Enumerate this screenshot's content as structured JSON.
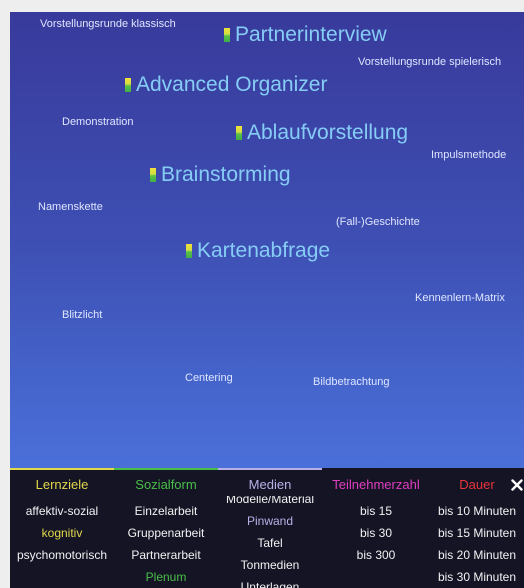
{
  "colors": {
    "background_top": "#383a9b",
    "background_bottom": "#4b70d9",
    "featured_word": "#86cdf5",
    "word": "#dfe6ff",
    "panel": "#141425",
    "item": "#f2f2f2"
  },
  "cloud": {
    "featured": [
      {
        "label": "Partnerinterview",
        "icon": "category-bar-icon"
      },
      {
        "label": "Advanced Organizer",
        "icon": "category-bar-icon"
      },
      {
        "label": "Ablaufvorstellung",
        "icon": "category-bar-icon"
      },
      {
        "label": "Brainstorming",
        "icon": "category-bar-icon"
      },
      {
        "label": "Kartenabfrage",
        "icon": "category-bar-icon"
      }
    ],
    "words": [
      "Vorstellungsrunde klassisch",
      "Vorstellungsrunde spielerisch",
      "Demonstration",
      "Impulsmethode",
      "Namenskette",
      "(Fall-)Geschichte",
      "Kennenlern-Matrix",
      "Blitzlicht",
      "Centering",
      "Bildbetrachtung"
    ]
  },
  "filters": {
    "columns": [
      {
        "title": "Lernziele",
        "color": "#e2d84a",
        "items": [
          "affektiv-sozial",
          "kognitiv",
          "psychomotorisch"
        ],
        "selected": [
          "kognitiv"
        ]
      },
      {
        "title": "Sozialform",
        "color": "#49bf47",
        "items": [
          "Einzelarbeit",
          "Gruppenarbeit",
          "Partnerarbeit",
          "Plenum"
        ],
        "selected": [
          "Plenum"
        ]
      },
      {
        "title": "Medien",
        "color": "#b7b1e8",
        "items": [
          "Modelle/Material",
          "Pinwand",
          "Tafel",
          "Tonmedien",
          "Unterlagen"
        ],
        "selected": [
          "Pinwand"
        ]
      },
      {
        "title": "Teilnehmerzahl",
        "color": "#e03ec0",
        "items": [
          "bis 15",
          "bis 30",
          "bis 300"
        ],
        "selected": []
      },
      {
        "title": "Dauer",
        "color": "#e8353b",
        "items": [
          "bis 10 Minuten",
          "bis 15 Minuten",
          "bis 20 Minuten",
          "bis 30 Minuten"
        ],
        "selected": []
      }
    ],
    "close_icon": "close-icon"
  }
}
